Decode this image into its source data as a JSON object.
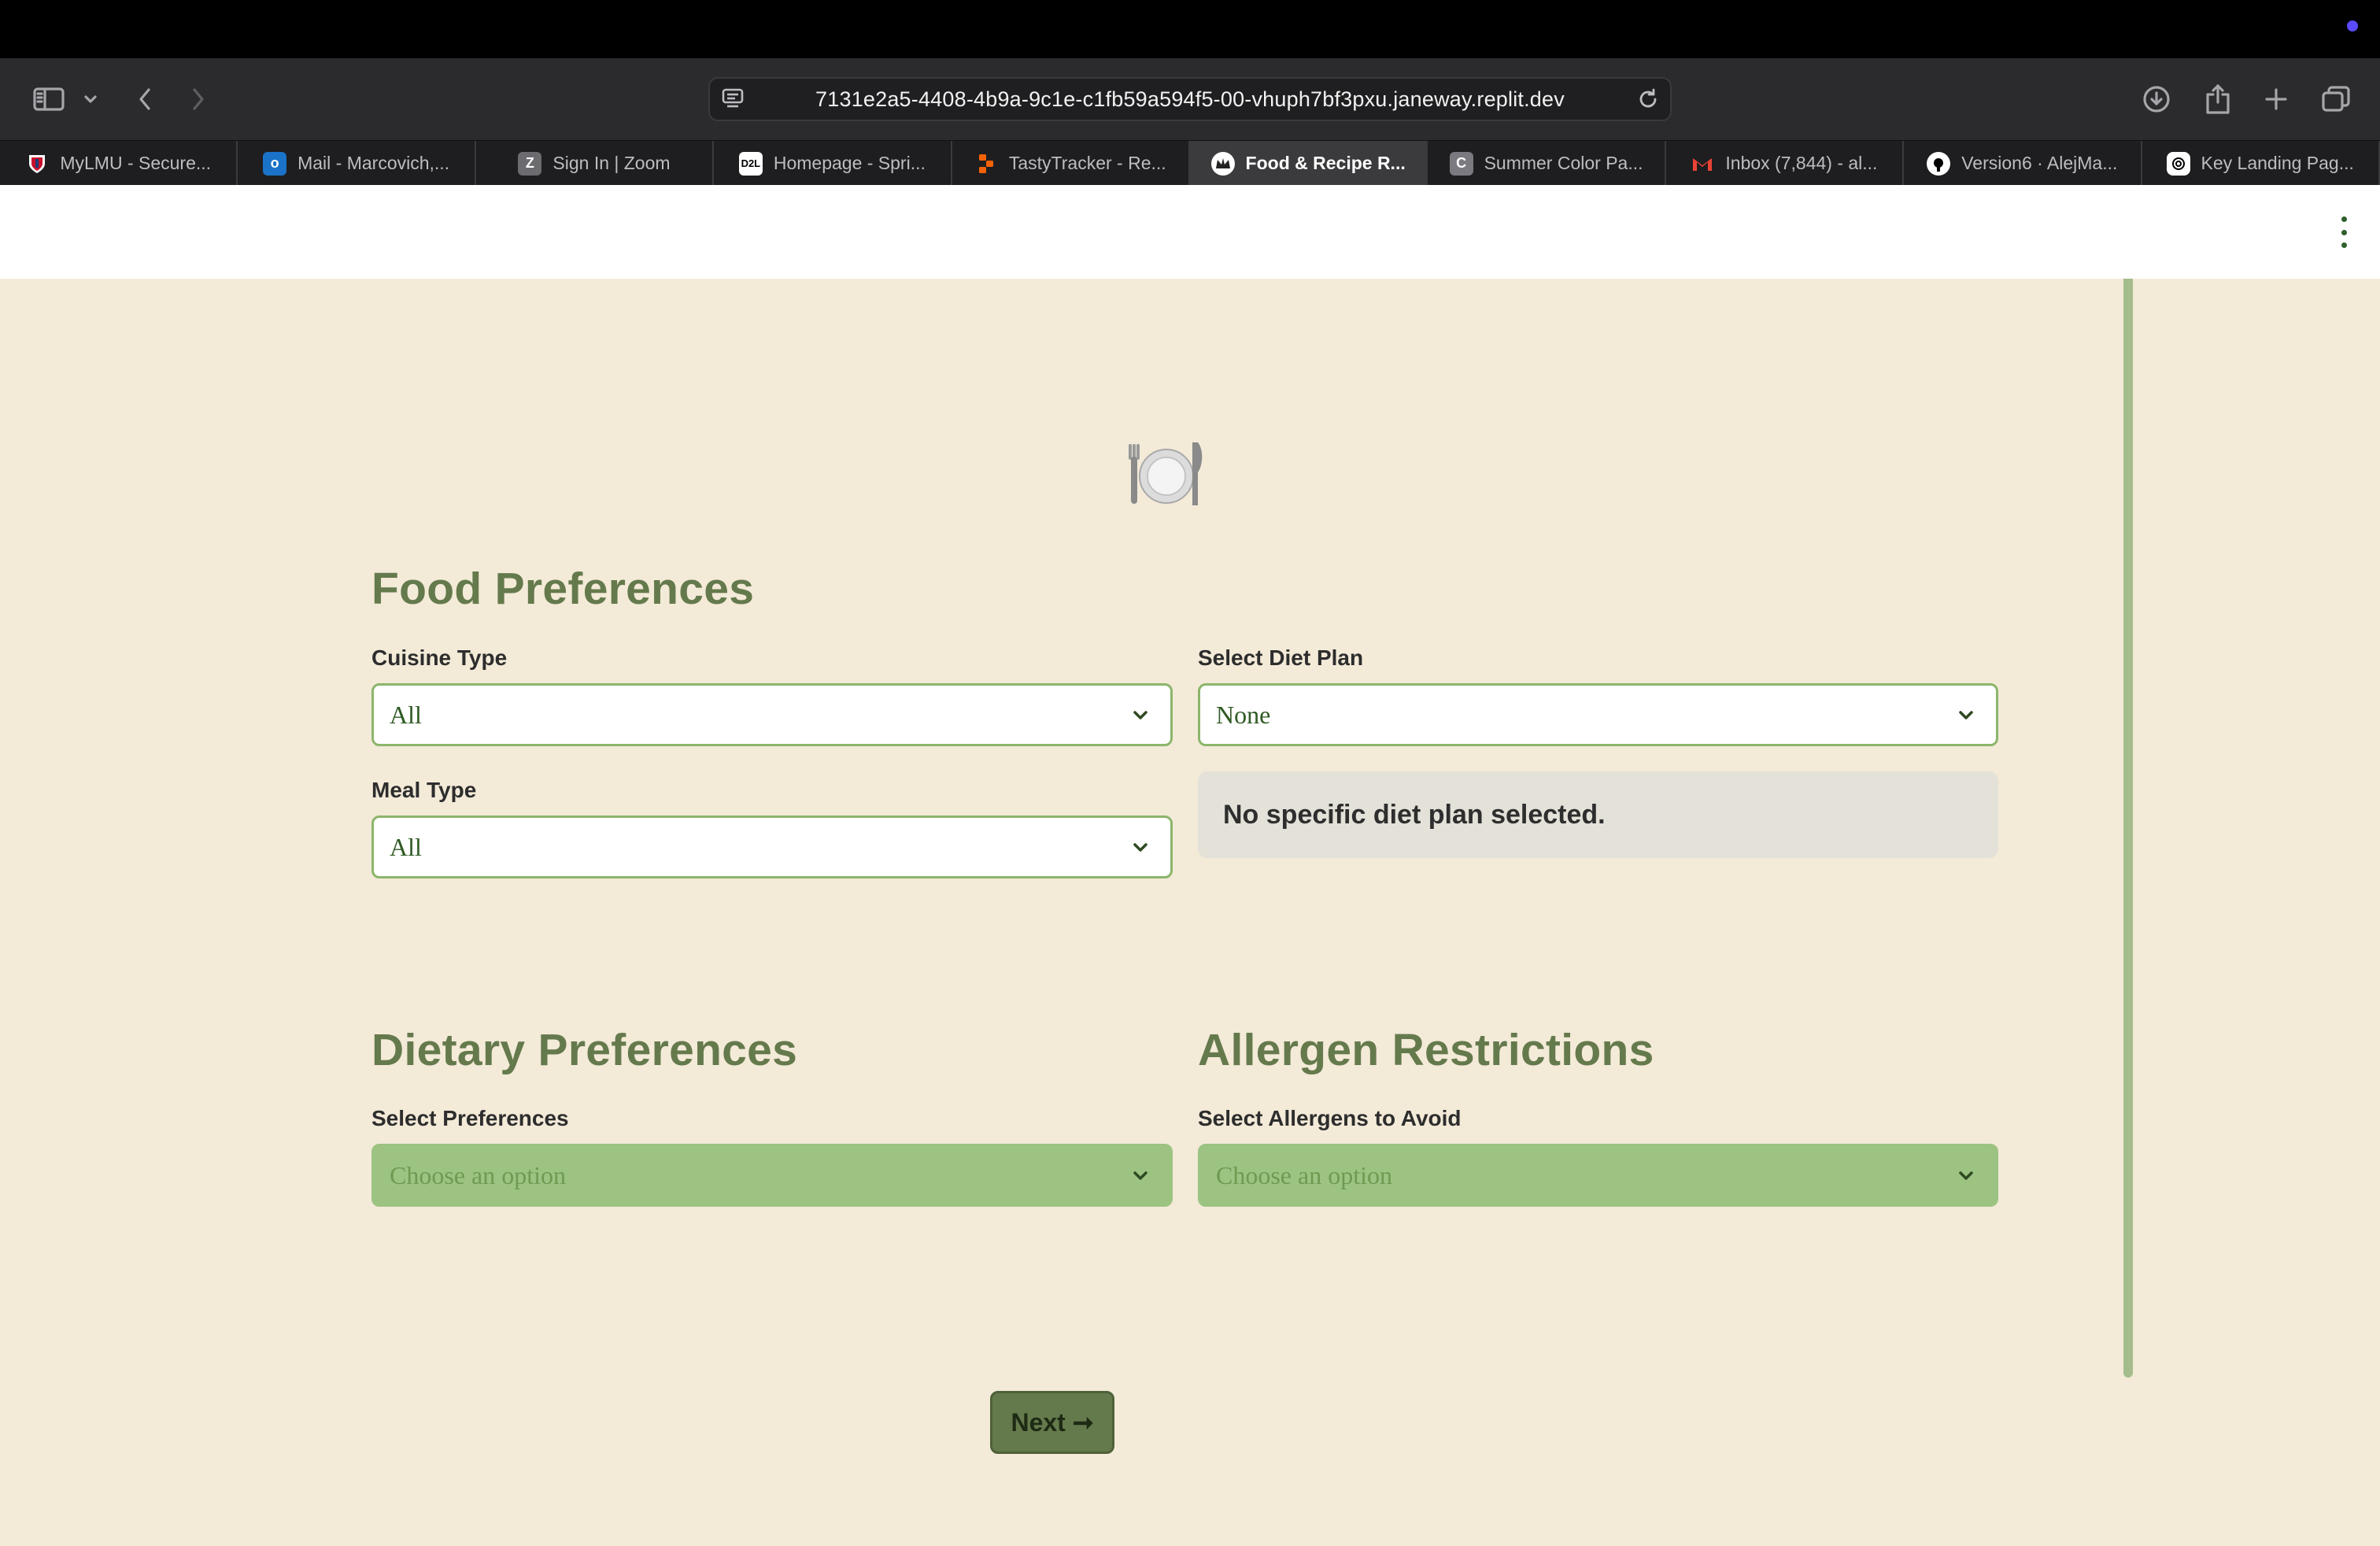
{
  "browser": {
    "url": "7131e2a5-4408-4b9a-9c1e-c1fb59a594f5-00-vhuph7bf3pxu.janeway.replit.dev",
    "tabs": [
      {
        "label": "MyLMU - Secure...",
        "icon": "lmu-shield-icon",
        "color": "#3b5fa8",
        "active": false
      },
      {
        "label": "Mail - Marcovich,...",
        "icon": "outlook-icon",
        "color": "#1a73c8",
        "active": false
      },
      {
        "label": "Sign In | Zoom",
        "icon": "zoom-z-icon",
        "color": "#6b6b70",
        "active": false
      },
      {
        "label": "Homepage - Spri...",
        "icon": "d2l-icon",
        "color": "#ffffff",
        "active": false
      },
      {
        "label": "TastyTracker - Re...",
        "icon": "replit-icon",
        "color": "#f26207",
        "active": false
      },
      {
        "label": "Food & Recipe R...",
        "icon": "replit-crown-icon",
        "color": "#ffffff",
        "active": true
      },
      {
        "label": "Summer Color Pa...",
        "icon": "coolors-c-icon",
        "color": "#7a7a80",
        "active": false
      },
      {
        "label": "Inbox (7,844) - al...",
        "icon": "gmail-icon",
        "color": "#ea4335",
        "active": false
      },
      {
        "label": "Version6 · AlejMa...",
        "icon": "github-icon",
        "color": "#ffffff",
        "active": false
      },
      {
        "label": "Key Landing Pag...",
        "icon": "openai-icon",
        "color": "#ffffff",
        "active": false
      }
    ]
  },
  "page": {
    "plate_icon": "plate-with-cutlery-icon",
    "food_preferences": {
      "title": "Food Preferences",
      "cuisine_label": "Cuisine Type",
      "cuisine_value": "All",
      "meal_label": "Meal Type",
      "meal_value": "All",
      "diet_label": "Select Diet Plan",
      "diet_value": "None",
      "diet_info": "No specific diet plan selected."
    },
    "dietary_preferences": {
      "title": "Dietary Preferences",
      "label": "Select Preferences",
      "placeholder": "Choose an option"
    },
    "allergen_restrictions": {
      "title": "Allergen Restrictions",
      "label": "Select Allergens to Avoid",
      "placeholder": "Choose an option"
    },
    "next_label": "Next ➞"
  },
  "colors": {
    "background": "#f3ead8",
    "heading": "#657a4c",
    "accent_green": "#9cc382",
    "button": "#657a4c"
  }
}
